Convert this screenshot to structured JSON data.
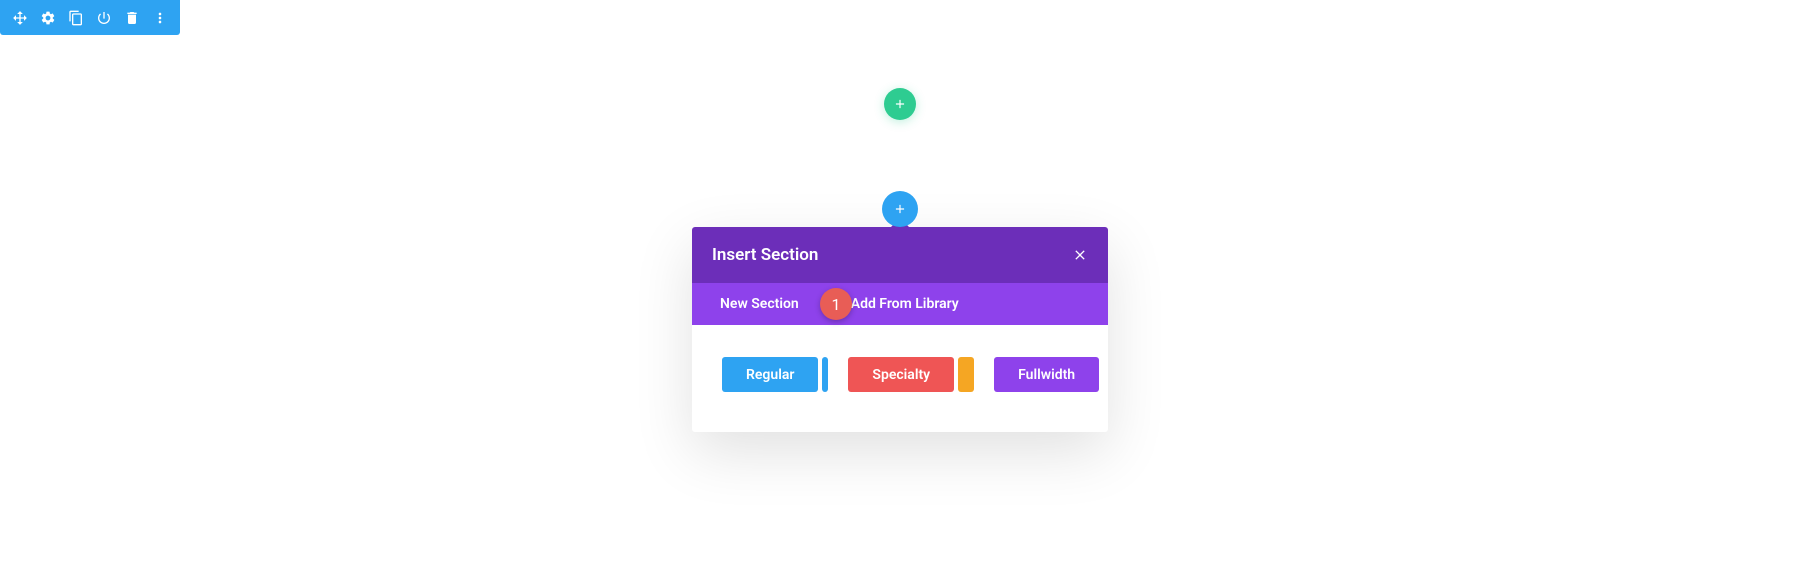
{
  "toolbar": {
    "icons": [
      "move",
      "settings",
      "duplicate",
      "power",
      "delete",
      "more"
    ]
  },
  "dialog": {
    "title": "Insert Section",
    "tabs": {
      "new_section": "New Section",
      "add_from_library": "Add From Library"
    },
    "annotation": "1",
    "section_types": {
      "regular": "Regular",
      "specialty": "Specialty",
      "fullwidth": "Fullwidth"
    }
  },
  "colors": {
    "toolbar_bg": "#2ea3f2",
    "add_row": "#2ecc91",
    "dialog_header": "#6c2eb9",
    "dialog_tabs": "#8e42eb",
    "btn_regular": "#2ea3f2",
    "btn_specialty": "#ef5555",
    "chip_specialty": "#f5a623",
    "btn_fullwidth": "#8e42eb",
    "annotation": "#e85d56"
  }
}
